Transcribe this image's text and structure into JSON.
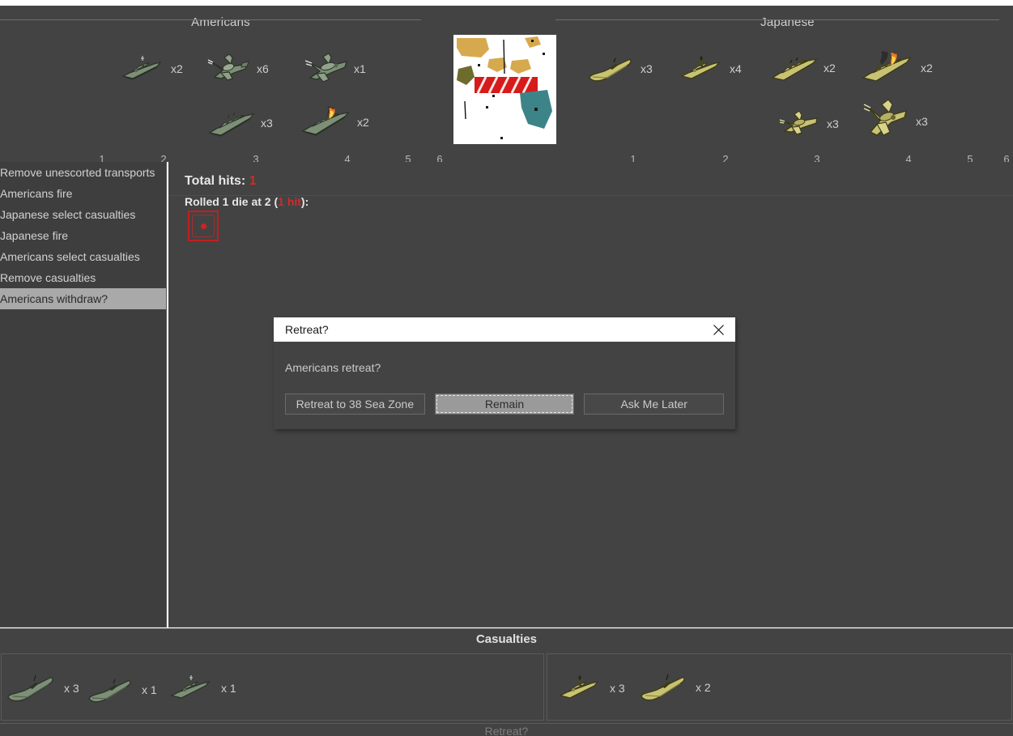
{
  "window": {
    "bottom_status": "Retreat?"
  },
  "battle": {
    "americans": {
      "title": "Americans",
      "scale_numbers": [
        "1",
        "2",
        "3",
        "4",
        "5",
        "6"
      ],
      "units_row1": [
        {
          "type": "destroyer",
          "count": "x2",
          "column": 2
        },
        {
          "type": "fighter",
          "count": "x6",
          "column": 3
        },
        {
          "type": "bomber",
          "count": "x1",
          "column": 4
        }
      ],
      "units_row2": [
        {
          "type": "battleship",
          "count": "x3",
          "column": 3
        },
        {
          "type": "damaged-battleship",
          "count": "x2",
          "column": 4
        }
      ]
    },
    "japanese": {
      "title": "Japanese",
      "scale_numbers": [
        "1",
        "2",
        "3",
        "4",
        "5",
        "6"
      ],
      "units_row1": [
        {
          "type": "submarine",
          "count": "x3",
          "column": 1
        },
        {
          "type": "destroyer",
          "count": "x4",
          "column": 2
        },
        {
          "type": "battleship",
          "count": "x2",
          "column": 3
        },
        {
          "type": "damaged-battleship",
          "count": "x2",
          "column": 4
        }
      ],
      "units_row2": [
        {
          "type": "fighter",
          "count": "x3",
          "column": 3
        },
        {
          "type": "bomber",
          "count": "x3",
          "column": 4
        }
      ]
    }
  },
  "steps": {
    "items": [
      {
        "label": "Remove unescorted transports",
        "selected": false
      },
      {
        "label": "Americans fire",
        "selected": false
      },
      {
        "label": "Japanese select casualties",
        "selected": false
      },
      {
        "label": "Japanese fire",
        "selected": false
      },
      {
        "label": "Americans select casualties",
        "selected": false
      },
      {
        "label": "Remove casualties",
        "selected": false
      },
      {
        "label": "Americans withdraw?",
        "selected": true
      }
    ]
  },
  "results": {
    "total_hits_label": "Total hits:",
    "total_hits_value": "1",
    "rolled_prefix": "Rolled 1 die at 2 (",
    "rolled_hits": "1 hit",
    "rolled_suffix": "):",
    "dice": [
      {
        "value": 1,
        "is_hit": true
      }
    ]
  },
  "dialog": {
    "title": "Retreat?",
    "close_icon": "close-icon",
    "message": "Americans retreat?",
    "buttons": [
      {
        "label": "Retreat to 38 Sea Zone",
        "focused": false
      },
      {
        "label": "Remain",
        "focused": true
      },
      {
        "label": "Ask Me Later",
        "focused": false
      }
    ]
  },
  "casualties": {
    "header": "Casualties",
    "americans": [
      {
        "type": "submarine",
        "count": "x 3"
      },
      {
        "type": "submarine",
        "count": "x 1"
      },
      {
        "type": "destroyer",
        "count": "x 1"
      }
    ],
    "japanese": [
      {
        "type": "destroyer",
        "count": "x 3"
      },
      {
        "type": "submarine",
        "count": "x 2"
      }
    ]
  },
  "colors": {
    "background": "#434343",
    "panel": "#3e3e3e",
    "text": "#cfcfcf",
    "hit_red": "#d02b2b",
    "selection": "#a9a9a9",
    "allied_unit": "#7d8f76",
    "axis_unit": "#c8c273"
  }
}
